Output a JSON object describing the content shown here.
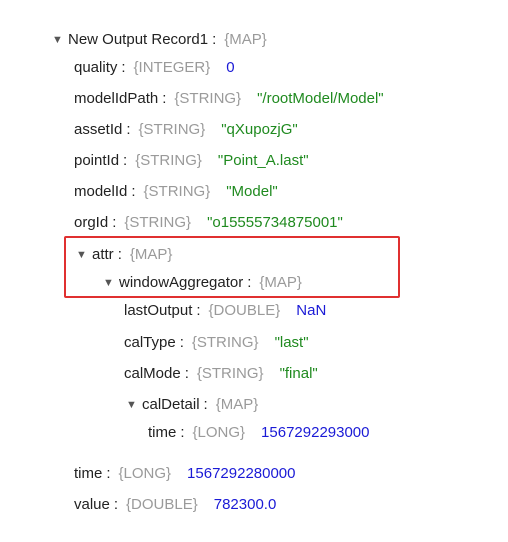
{
  "root": {
    "key": "New Output Record1",
    "type": "{MAP}"
  },
  "fields": {
    "quality": {
      "key": "quality",
      "type": "{INTEGER}",
      "value": "0"
    },
    "modelIdPath": {
      "key": "modelIdPath",
      "type": "{STRING}",
      "value": "\"/rootModel/Model\""
    },
    "assetId": {
      "key": "assetId",
      "type": "{STRING}",
      "value": "\"qXupozjG\""
    },
    "pointId": {
      "key": "pointId",
      "type": "{STRING}",
      "value": "\"Point_A.last\""
    },
    "modelId": {
      "key": "modelId",
      "type": "{STRING}",
      "value": "\"Model\""
    },
    "orgId": {
      "key": "orgId",
      "type": "{STRING}",
      "value": "\"o15555734875001\""
    },
    "attr": {
      "key": "attr",
      "type": "{MAP}"
    },
    "windowAggregator": {
      "key": "windowAggregator",
      "type": "{MAP}"
    },
    "lastOutput": {
      "key": "lastOutput",
      "type": "{DOUBLE}",
      "value": "NaN"
    },
    "calType": {
      "key": "calType",
      "type": "{STRING}",
      "value": "\"last\""
    },
    "calMode": {
      "key": "calMode",
      "type": "{STRING}",
      "value": "\"final\""
    },
    "calDetail": {
      "key": "calDetail",
      "type": "{MAP}"
    },
    "calDetailTime": {
      "key": "time",
      "type": "{LONG}",
      "value": "1567292293000"
    },
    "time": {
      "key": "time",
      "type": "{LONG}",
      "value": "1567292280000"
    },
    "value": {
      "key": "value",
      "type": "{DOUBLE}",
      "value": "782300.0"
    }
  },
  "icons": {
    "expanded": "▼"
  },
  "colors": {
    "type": "#9a9a9a",
    "number": "#1a1ad6",
    "string": "#1f8a1f",
    "highlight": "#e03030"
  }
}
